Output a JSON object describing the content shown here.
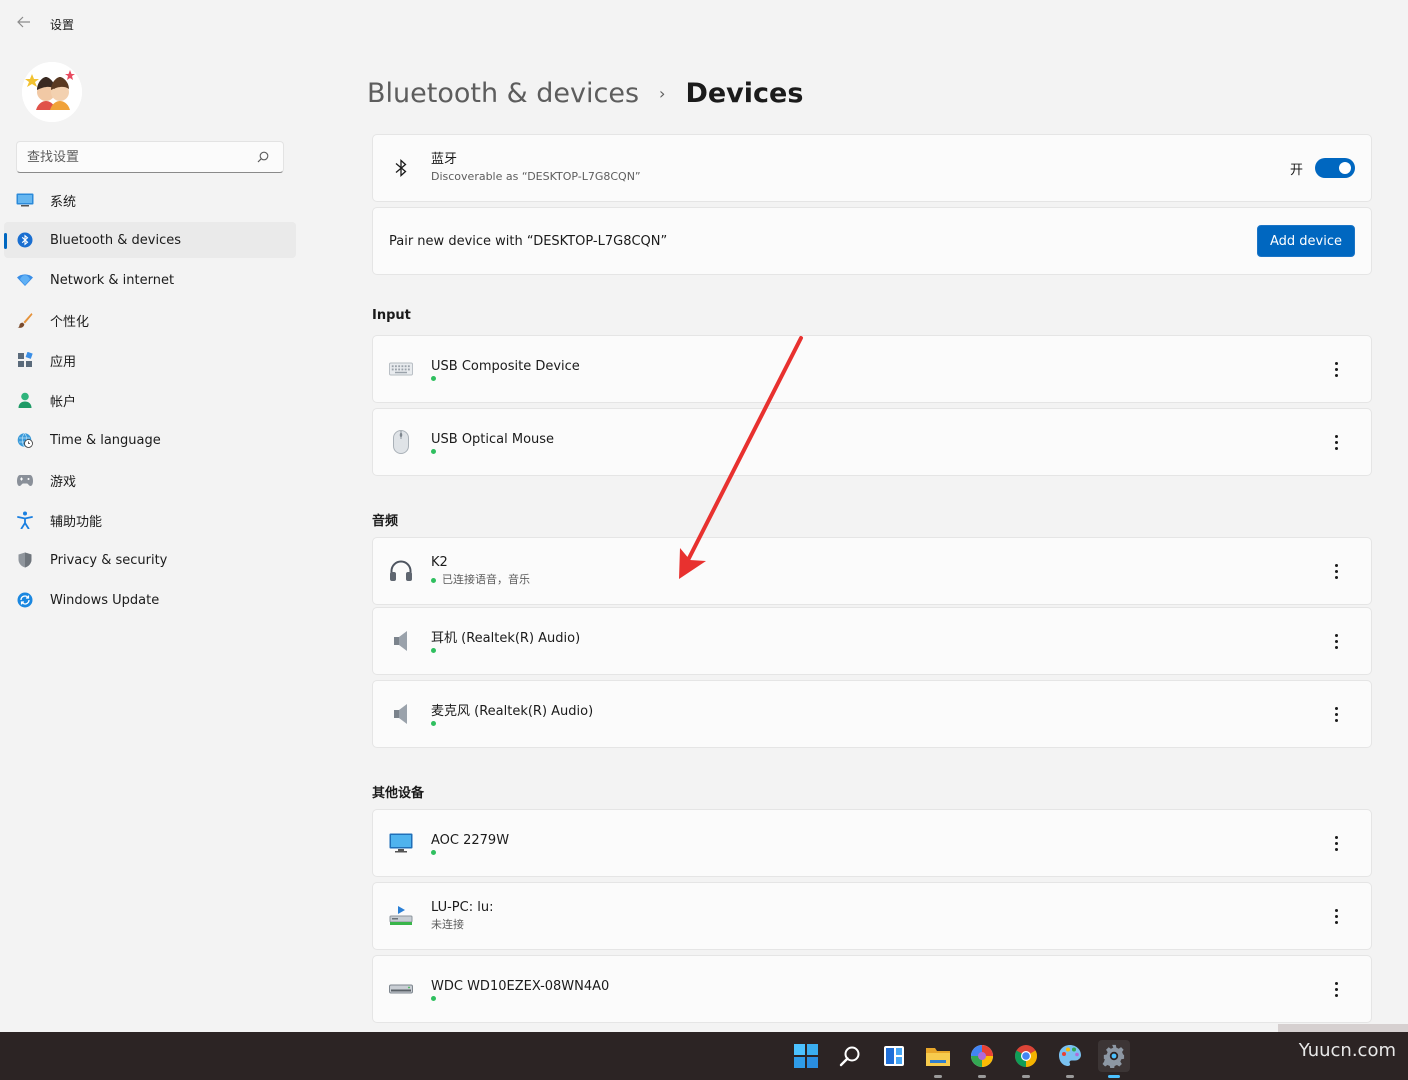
{
  "window": {
    "app_title": "设置",
    "back_icon": "back-arrow-icon"
  },
  "sidebar": {
    "search_placeholder": "查找设置",
    "items": [
      {
        "label": "系统",
        "icon": "system-monitor-icon",
        "active": false
      },
      {
        "label": "Bluetooth & devices",
        "icon": "bluetooth-icon",
        "active": true
      },
      {
        "label": "Network & internet",
        "icon": "wifi-icon",
        "active": false
      },
      {
        "label": "个性化",
        "icon": "brush-icon",
        "active": false
      },
      {
        "label": "应用",
        "icon": "apps-icon",
        "active": false
      },
      {
        "label": "帐户",
        "icon": "user-icon",
        "active": false
      },
      {
        "label": "Time & language",
        "icon": "globe-clock-icon",
        "active": false
      },
      {
        "label": "游戏",
        "icon": "gamepad-icon",
        "active": false
      },
      {
        "label": "辅助功能",
        "icon": "accessibility-icon",
        "active": false
      },
      {
        "label": "Privacy & security",
        "icon": "shield-icon",
        "active": false
      },
      {
        "label": "Windows Update",
        "icon": "update-icon",
        "active": false
      }
    ]
  },
  "breadcrumb": {
    "parent": "Bluetooth & devices",
    "separator": "›",
    "current": "Devices"
  },
  "bluetooth": {
    "title": "蓝牙",
    "subtitle": "Discoverable as “DESKTOP-L7G8CQN”",
    "toggle_label": "开",
    "toggle_on": true
  },
  "pair": {
    "label": "Pair new device with “DESKTOP-L7G8CQN”",
    "button": "Add device"
  },
  "sections": {
    "input": "Input",
    "audio": "音频",
    "other": "其他设备"
  },
  "devices": {
    "input": [
      {
        "name": "USB Composite Device",
        "status": "",
        "icon": "keyboard-icon"
      },
      {
        "name": "USB Optical Mouse",
        "status": "",
        "icon": "mouse-icon"
      }
    ],
    "audio": [
      {
        "name": "K2",
        "status": "已连接语音，音乐",
        "icon": "headphones-icon"
      },
      {
        "name": "耳机 (Realtek(R) Audio)",
        "status": "",
        "icon": "speaker-icon"
      },
      {
        "name": "麦克风 (Realtek(R) Audio)",
        "status": "",
        "icon": "speaker-icon"
      }
    ],
    "other": [
      {
        "name": "AOC 2279W",
        "status": "",
        "icon": "monitor-icon"
      },
      {
        "name": "LU-PC: lu:",
        "status": "未连接",
        "icon": "media-server-icon"
      },
      {
        "name": "WDC WD10EZEX-08WN4A0",
        "status": "",
        "icon": "hard-drive-icon"
      }
    ]
  },
  "colors": {
    "accent": "#0067c0",
    "status_green": "#2fbf5f",
    "annotation_red": "#e8312f"
  },
  "watermark": "Yuucn.com"
}
